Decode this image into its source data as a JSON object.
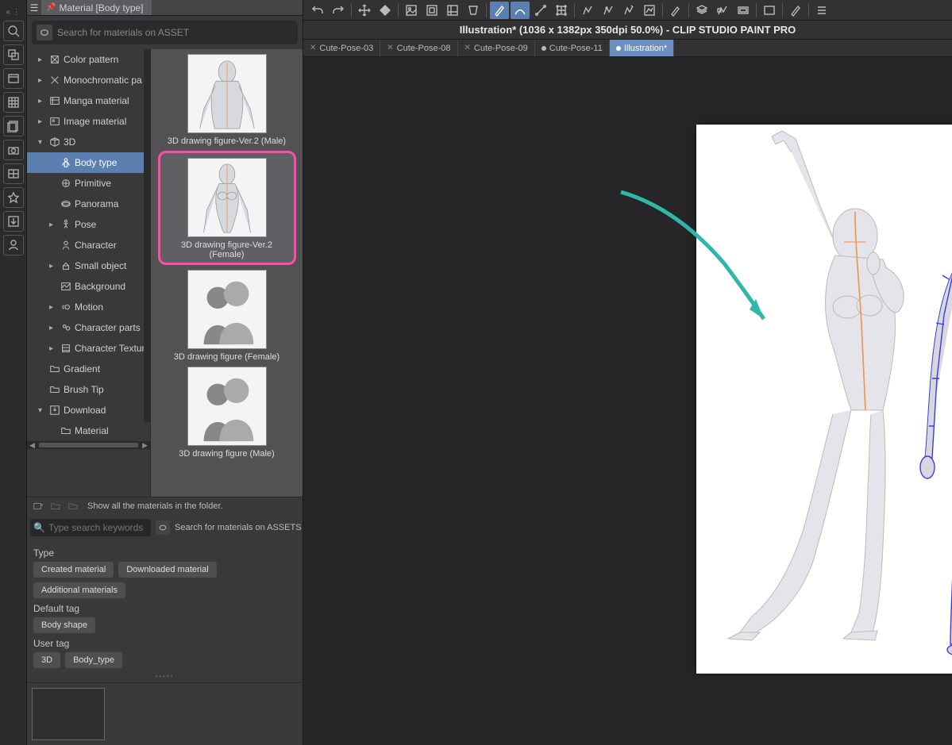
{
  "panel": {
    "title": "Material [Body type]",
    "search_assets_placeholder": "Search for materials on ASSET"
  },
  "tree": {
    "items": [
      {
        "label": "Color pattern",
        "expand": ">",
        "indent": 1,
        "icon": "color"
      },
      {
        "label": "Monochromatic pa",
        "expand": ">",
        "indent": 1,
        "icon": "mono"
      },
      {
        "label": "Manga material",
        "expand": ">",
        "indent": 1,
        "icon": "manga"
      },
      {
        "label": "Image material",
        "expand": ">",
        "indent": 1,
        "icon": "image"
      },
      {
        "label": "3D",
        "expand": "v",
        "indent": 1,
        "icon": "3d"
      },
      {
        "label": "Body type",
        "expand": "",
        "indent": 2,
        "icon": "body",
        "selected": true
      },
      {
        "label": "Primitive",
        "expand": "",
        "indent": 2,
        "icon": "prim"
      },
      {
        "label": "Panorama",
        "expand": "",
        "indent": 2,
        "icon": "pano"
      },
      {
        "label": "Pose",
        "expand": ">",
        "indent": 2,
        "icon": "pose"
      },
      {
        "label": "Character",
        "expand": "",
        "indent": 2,
        "icon": "char"
      },
      {
        "label": "Small object",
        "expand": ">",
        "indent": 2,
        "icon": "obj"
      },
      {
        "label": "Background",
        "expand": "",
        "indent": 2,
        "icon": "bg"
      },
      {
        "label": "Motion",
        "expand": ">",
        "indent": 2,
        "icon": "motion"
      },
      {
        "label": "Character parts",
        "expand": ">",
        "indent": 2,
        "icon": "parts"
      },
      {
        "label": "Character Textur",
        "expand": ">",
        "indent": 2,
        "icon": "tex"
      },
      {
        "label": "Gradient",
        "expand": "",
        "indent": 1,
        "icon": "folder"
      },
      {
        "label": "Brush Tip",
        "expand": "",
        "indent": 1,
        "icon": "folder"
      },
      {
        "label": "Download",
        "expand": "v",
        "indent": 1,
        "icon": "dl"
      },
      {
        "label": "Material",
        "expand": "",
        "indent": 2,
        "icon": "folder"
      }
    ]
  },
  "thumbs": [
    {
      "label": "3D drawing figure-Ver.2 (Male)",
      "shape": "male",
      "highlight": false
    },
    {
      "label": "3D drawing figure-Ver.2 (Female)",
      "shape": "female",
      "highlight": true
    },
    {
      "label": "3D drawing figure (Female)",
      "shape": "silhouette",
      "highlight": false
    },
    {
      "label": "3D drawing figure (Male)",
      "shape": "silhouette",
      "highlight": false
    }
  ],
  "lower": {
    "show_all": "Show all the materials in the folder.",
    "kw_placeholder": "Type search keywords",
    "assets_link": "Search for materials on ASSETS",
    "type_label": "Type",
    "type_chips": [
      "Created material",
      "Downloaded material",
      "Additional materials"
    ],
    "default_tag_label": "Default tag",
    "default_tag_chips": [
      "Body shape"
    ],
    "user_tag_label": "User tag",
    "user_tag_chips": [
      "3D",
      "Body_type"
    ]
  },
  "app": {
    "titlebar": "Illustration* (1036 x 1382px 350dpi 50.0%)  - CLIP STUDIO PAINT PRO"
  },
  "tabs": [
    {
      "label": "Cute-Pose-03",
      "close": true,
      "active": false,
      "dot": false
    },
    {
      "label": "Cute-Pose-08",
      "close": true,
      "active": false,
      "dot": false
    },
    {
      "label": "Cute-Pose-09",
      "close": true,
      "active": false,
      "dot": false
    },
    {
      "label": "Cute-Pose-11",
      "close": false,
      "active": false,
      "dot": true
    },
    {
      "label": "Illustration*",
      "close": false,
      "active": true,
      "dot": true
    }
  ]
}
